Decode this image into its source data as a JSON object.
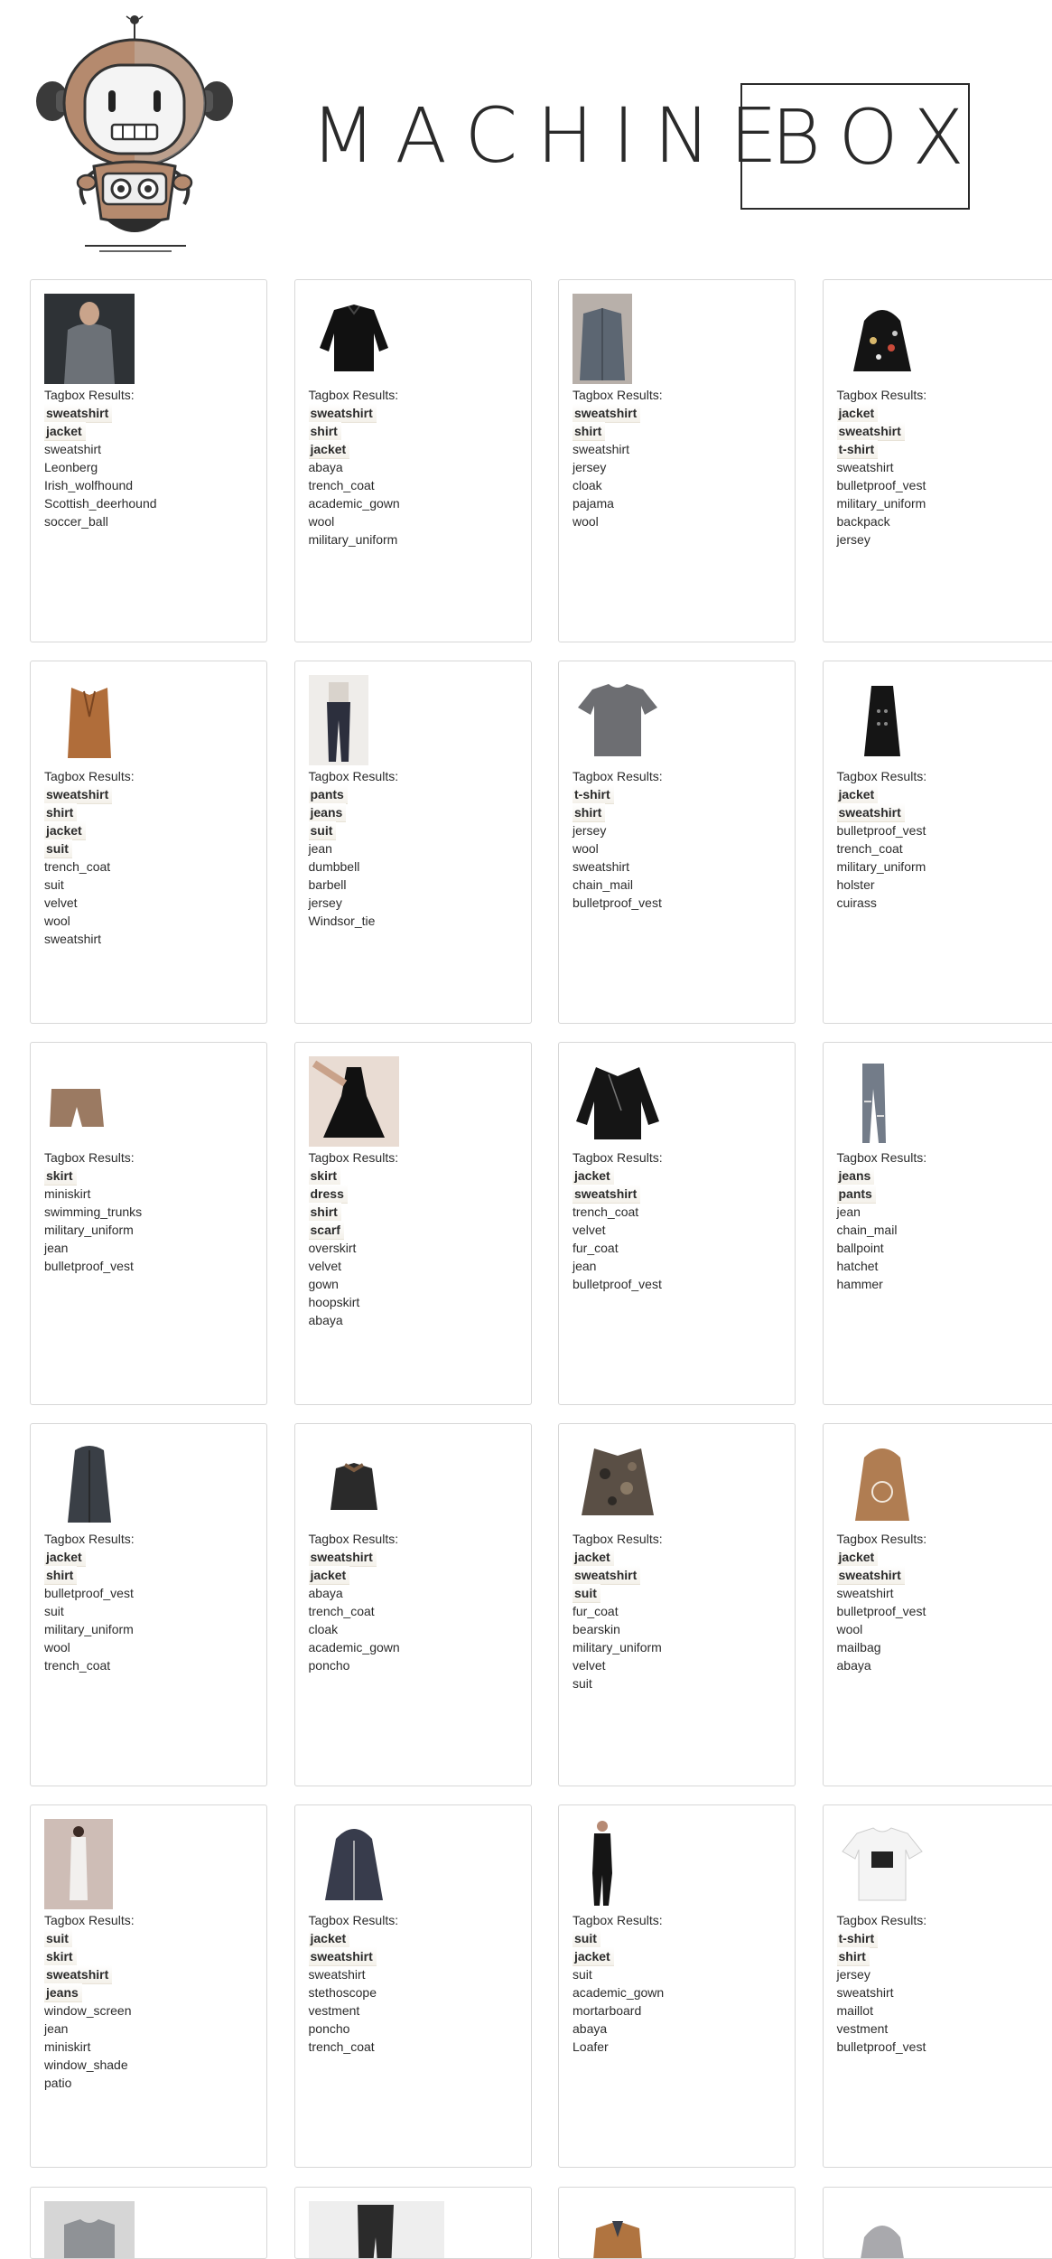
{
  "brand": {
    "word1": "MACHINE",
    "word2": "BOX"
  },
  "results_label": "Tagbox Results:",
  "cards": [
    {
      "image": "gray-sweatshirt-model",
      "highlighted": [
        "sweatshirt",
        "jacket"
      ],
      "tags": [
        "sweatshirt",
        "Leonberg",
        "Irish_wolfhound",
        "Scottish_deerhound",
        "soccer_ball"
      ]
    },
    {
      "image": "black-jacket",
      "highlighted": [
        "sweatshirt",
        "shirt",
        "jacket"
      ],
      "tags": [
        "abaya",
        "trench_coat",
        "academic_gown",
        "wool",
        "military_uniform"
      ]
    },
    {
      "image": "gray-shirt-hanger",
      "highlighted": [
        "sweatshirt",
        "shirt"
      ],
      "tags": [
        "sweatshirt",
        "jersey",
        "cloak",
        "pajama",
        "wool"
      ]
    },
    {
      "image": "black-patch-parka",
      "highlighted": [
        "jacket",
        "sweatshirt",
        "t-shirt"
      ],
      "tags": [
        "sweatshirt",
        "bulletproof_vest",
        "military_uniform",
        "backpack",
        "jersey"
      ]
    },
    {
      "image": "tan-blazer",
      "highlighted": [
        "sweatshirt",
        "shirt",
        "jacket",
        "suit"
      ],
      "tags": [
        "trench_coat",
        "suit",
        "velvet",
        "wool",
        "sweatshirt"
      ]
    },
    {
      "image": "jeans-model",
      "highlighted": [
        "pants",
        "jeans",
        "suit"
      ],
      "tags": [
        "jean",
        "dumbbell",
        "barbell",
        "jersey",
        "Windsor_tie"
      ]
    },
    {
      "image": "gray-tshirt",
      "highlighted": [
        "t-shirt",
        "shirt"
      ],
      "tags": [
        "jersey",
        "wool",
        "sweatshirt",
        "chain_mail",
        "bulletproof_vest"
      ]
    },
    {
      "image": "black-coat",
      "highlighted": [
        "jacket",
        "sweatshirt"
      ],
      "tags": [
        "bulletproof_vest",
        "trench_coat",
        "military_uniform",
        "holster",
        "cuirass"
      ]
    },
    {
      "image": "tan-shorts",
      "highlighted": [
        "skirt"
      ],
      "tags": [
        "miniskirt",
        "swimming_trunks",
        "military_uniform",
        "jean",
        "bulletproof_vest"
      ]
    },
    {
      "image": "black-dress-flatlay",
      "highlighted": [
        "skirt",
        "dress",
        "shirt",
        "scarf"
      ],
      "tags": [
        "overskirt",
        "velvet",
        "gown",
        "hoopskirt",
        "abaya"
      ]
    },
    {
      "image": "leather-jacket",
      "highlighted": [
        "jacket",
        "sweatshirt"
      ],
      "tags": [
        "trench_coat",
        "velvet",
        "fur_coat",
        "jean",
        "bulletproof_vest"
      ]
    },
    {
      "image": "ripped-jeans",
      "highlighted": [
        "jeans",
        "pants"
      ],
      "tags": [
        "jean",
        "chain_mail",
        "ballpoint",
        "hatchet",
        "hammer"
      ]
    },
    {
      "image": "gray-parka",
      "highlighted": [
        "jacket",
        "shirt"
      ],
      "tags": [
        "bulletproof_vest",
        "suit",
        "military_uniform",
        "wool",
        "trench_coat"
      ]
    },
    {
      "image": "bomber-jacket",
      "highlighted": [
        "sweatshirt",
        "jacket"
      ],
      "tags": [
        "abaya",
        "trench_coat",
        "cloak",
        "academic_gown",
        "poncho"
      ]
    },
    {
      "image": "camo-jacket",
      "highlighted": [
        "jacket",
        "sweatshirt",
        "suit"
      ],
      "tags": [
        "fur_coat",
        "bearskin",
        "military_uniform",
        "velvet",
        "suit"
      ]
    },
    {
      "image": "tan-hoodie",
      "highlighted": [
        "jacket",
        "sweatshirt"
      ],
      "tags": [
        "sweatshirt",
        "bulletproof_vest",
        "wool",
        "mailbag",
        "abaya"
      ]
    },
    {
      "image": "white-outfit-model",
      "highlighted": [
        "suit",
        "skirt",
        "sweatshirt",
        "jeans"
      ],
      "tags": [
        "window_screen",
        "jean",
        "miniskirt",
        "window_shade",
        "patio"
      ]
    },
    {
      "image": "navy-hoodie",
      "highlighted": [
        "jacket",
        "sweatshirt"
      ],
      "tags": [
        "sweatshirt",
        "stethoscope",
        "vestment",
        "poncho",
        "trench_coat"
      ]
    },
    {
      "image": "black-suit-model",
      "highlighted": [
        "suit",
        "jacket"
      ],
      "tags": [
        "suit",
        "academic_gown",
        "mortarboard",
        "abaya",
        "Loafer"
      ]
    },
    {
      "image": "white-tshirt-print",
      "highlighted": [
        "t-shirt",
        "shirt"
      ],
      "tags": [
        "jersey",
        "sweatshirt",
        "maillot",
        "vestment",
        "bulletproof_vest"
      ]
    }
  ],
  "partial_cards": [
    {
      "image": "gray-graphic-tee"
    },
    {
      "image": "dark-pants"
    },
    {
      "image": "tan-jacket-collar"
    },
    {
      "image": "gray-hoodie"
    }
  ],
  "colors": {
    "border": "#d7d7d7",
    "text": "#2b2b2b",
    "robot_brown": "#b58a6e",
    "robot_dark": "#3a3a3a"
  }
}
